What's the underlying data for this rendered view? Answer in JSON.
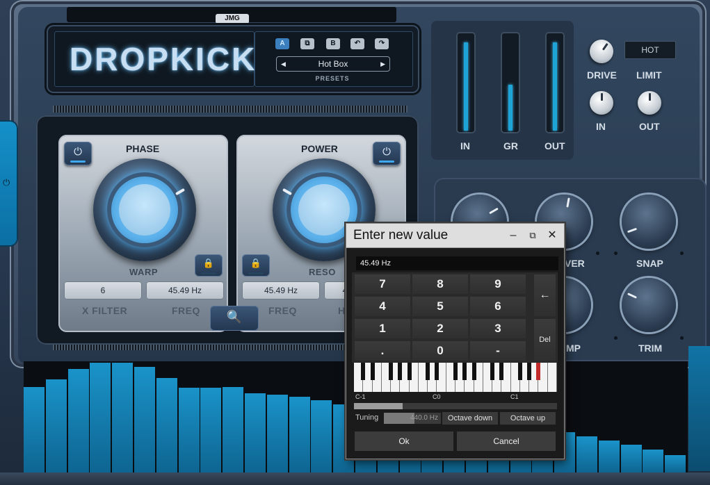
{
  "app": {
    "logo": "DROPKICK",
    "brand": "JMG"
  },
  "presets": {
    "buttons": [
      "A",
      "⧉",
      "B",
      "↶",
      "↷"
    ],
    "current": "Hot Box",
    "label": "PRESETS",
    "prev_icon": "◀",
    "next_icon": "▶"
  },
  "modules": {
    "left": {
      "title": "PHASE",
      "knob_label": "WARP",
      "value1": "6",
      "value2": "45.49 Hz",
      "label1": "X FILTER",
      "label2": "FREQ"
    },
    "right": {
      "title": "POWER",
      "knob_label": "RESO",
      "value1": "45.49 Hz",
      "value2": "4",
      "label1": "FREQ",
      "label2": "HI"
    }
  },
  "meters": [
    {
      "label": "IN",
      "level": 0.92
    },
    {
      "label": "GR",
      "level": 0.48
    },
    {
      "label": "OUT",
      "level": 0.92
    }
  ],
  "right_controls": {
    "drive": "DRIVE",
    "limit": "LIMIT",
    "limit_mode": "HOT",
    "in": "IN",
    "out": "OUT"
  },
  "big_knobs": [
    "",
    "VER",
    "SNAP",
    "",
    "MP",
    "TRIM"
  ],
  "spectrum_levels": [
    0.78,
    0.85,
    0.94,
    1.0,
    1.0,
    0.96,
    0.86,
    0.77,
    0.77,
    0.78,
    0.72,
    0.71,
    0.69,
    0.66,
    0.62,
    0.57,
    0.56,
    0.54,
    0.52,
    0.49,
    0.47,
    0.45,
    0.43,
    0.42,
    0.37,
    0.33,
    0.29,
    0.25,
    0.21,
    0.16
  ],
  "dialog": {
    "title": "Enter new value",
    "minimize_icon": "‒",
    "restore_icon": "⧉",
    "close_icon": "✕",
    "input_value": "45.49 Hz",
    "keys": [
      "7",
      "8",
      "9",
      "4",
      "5",
      "6",
      "1",
      "2",
      "3",
      ".",
      "0",
      "-"
    ],
    "backspace_icon": "←",
    "del_label": "Del",
    "octave_labels": [
      "C-1",
      "C0",
      "C1"
    ],
    "tuning_label": "Tuning",
    "tuning_value": "440.0 Hz",
    "octave_down": "Octave down",
    "octave_up": "Octave up",
    "ok": "Ok",
    "cancel": "Cancel"
  },
  "icons": {
    "power": "⏻",
    "lock": "🔒",
    "search": "🔍"
  }
}
